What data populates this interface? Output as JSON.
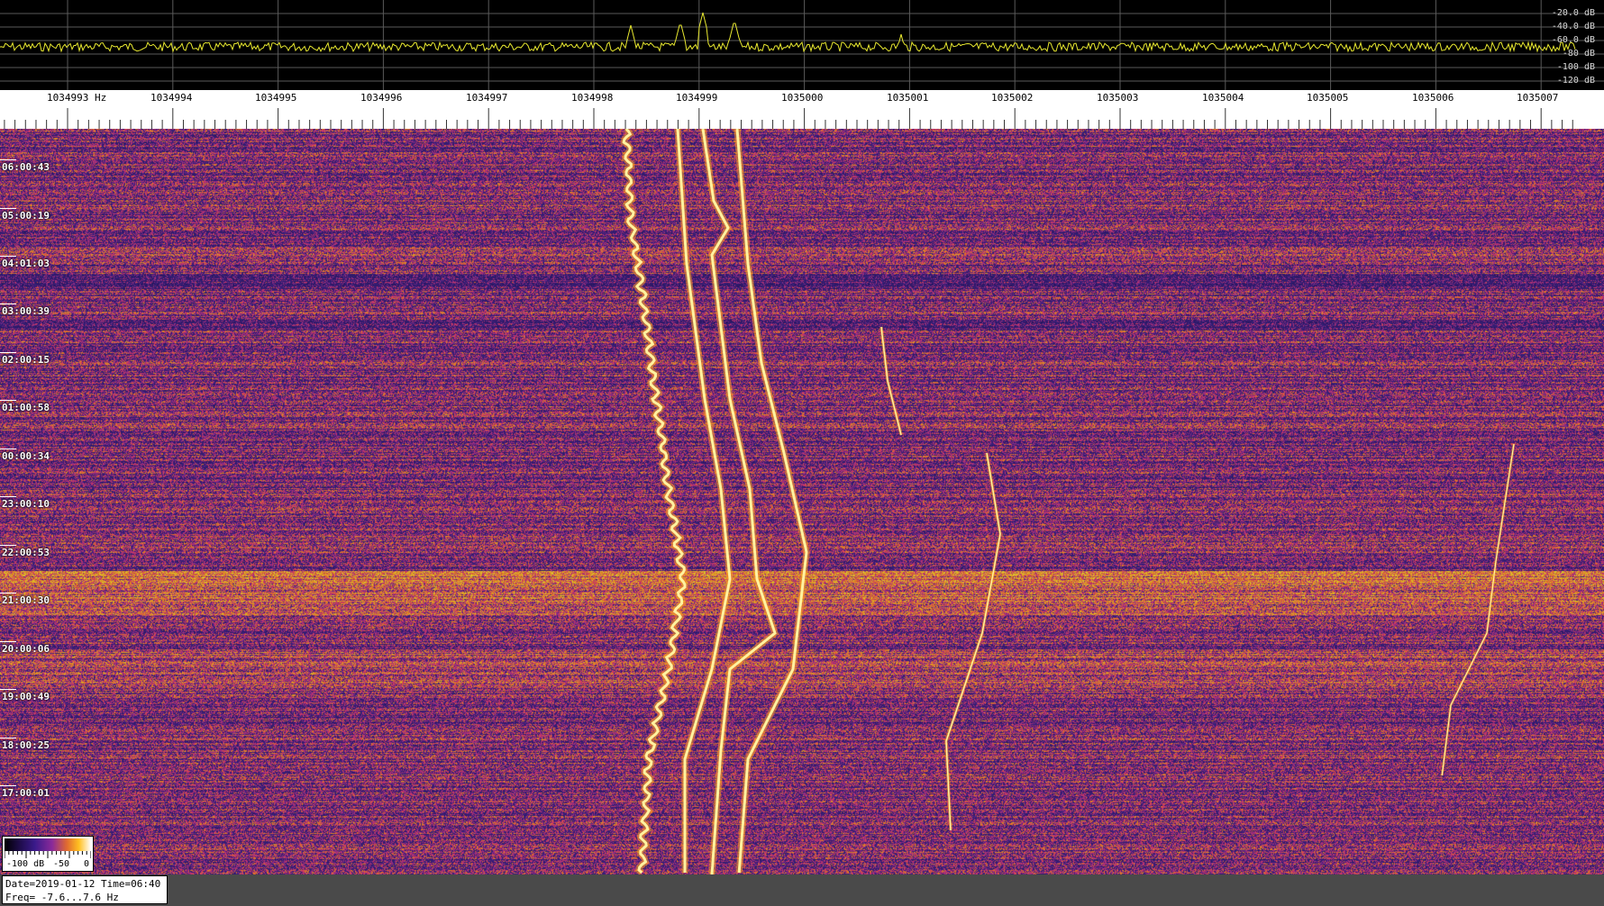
{
  "spectrum": {
    "db_labels": [
      "-20.0 dB",
      "-40.0 dB",
      "-60.0 dB",
      "-80 dB",
      "-100 dB",
      "-120 dB"
    ],
    "trace_color": "#e8e830",
    "grid_color": "#5a5a5a"
  },
  "frequency_axis": {
    "labels": [
      "1034993 Hz",
      "1034994",
      "1034995",
      "1034996",
      "1034997",
      "1034998",
      "1034999",
      "1035000",
      "1035001",
      "1035002",
      "1035003",
      "1035004",
      "1035005",
      "1035006",
      "1035007"
    ]
  },
  "time_axis": {
    "labels": [
      "06:00:43",
      "05:00:19",
      "04:01:03",
      "03:00:39",
      "02:00:15",
      "01:00:58",
      "00:00:34",
      "23:00:10",
      "22:00:53",
      "21:00:30",
      "20:00:06",
      "19:00:49",
      "18:00:25",
      "17:00:01"
    ]
  },
  "colorbar": {
    "min_label": "-100 dB",
    "mid_label": "-50",
    "max_label": "0"
  },
  "info": {
    "date_time": "Date=2019-01-12 Time=06:40",
    "freq_range": "Freq= -7.6...7.6 Hz"
  },
  "colors": {
    "waterfall_bg": "#2a1f7a",
    "signal_core": "#fff2a0",
    "signal_glow": "#ffa020"
  }
}
